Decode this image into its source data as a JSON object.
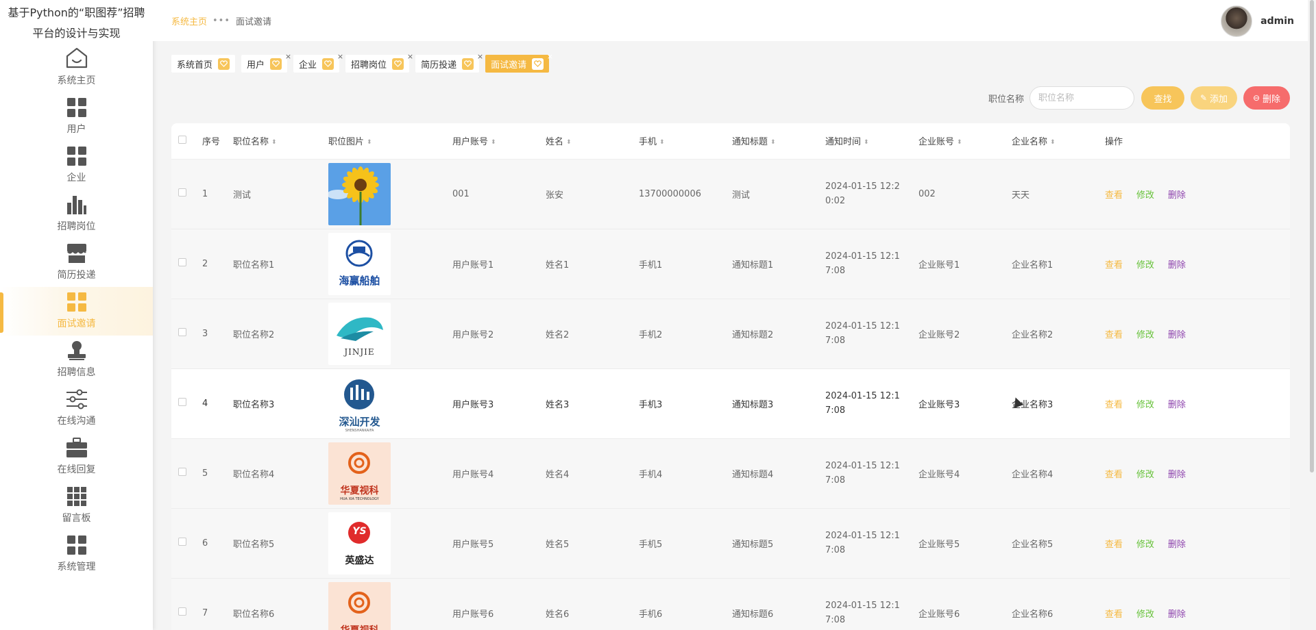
{
  "app": {
    "title": "基于Python的“职图荐”招聘平台的设计与实现"
  },
  "sidebar": {
    "items": [
      {
        "label": "系统主页",
        "icon": "home-icon"
      },
      {
        "label": "用户",
        "icon": "grid-icon"
      },
      {
        "label": "企业",
        "icon": "grid-icon"
      },
      {
        "label": "招聘岗位",
        "icon": "bar-chart-icon"
      },
      {
        "label": "简历投递",
        "icon": "store-icon"
      },
      {
        "label": "面试邀请",
        "icon": "grid-icon"
      },
      {
        "label": "招聘信息",
        "icon": "stamp-icon"
      },
      {
        "label": "在线沟通",
        "icon": "sliders-icon"
      },
      {
        "label": "在线回复",
        "icon": "briefcase-icon"
      },
      {
        "label": "留言板",
        "icon": "grid-nine-icon"
      },
      {
        "label": "系统管理",
        "icon": "grid-icon"
      }
    ]
  },
  "header": {
    "breadcrumb_home": "系统主页",
    "breadcrumb_sep": "•••",
    "breadcrumb_current": "面试邀请",
    "user_name": "admin"
  },
  "tags": [
    {
      "label": "系统首页"
    },
    {
      "label": "用户"
    },
    {
      "label": "企业"
    },
    {
      "label": "招聘岗位"
    },
    {
      "label": "简历投递"
    },
    {
      "label": "面试邀请"
    }
  ],
  "search": {
    "label": "职位名称",
    "placeholder": "职位名称",
    "find_label": "查找",
    "add_label": "添加",
    "delete_label": "删除"
  },
  "table": {
    "headers": [
      "序号",
      "职位名称",
      "职位图片",
      "用户账号",
      "姓名",
      "手机",
      "通知标题",
      "通知时间",
      "企业账号",
      "企业名称",
      "操作"
    ],
    "actions": {
      "view": "查看",
      "edit": "修改",
      "delete": "删除"
    },
    "rows": [
      {
        "no": "1",
        "job": "测试",
        "image": "sunflower",
        "account": "001",
        "name": "张安",
        "phone": "13700000006",
        "notice": "测试",
        "time": "2024-01-15 12:20:02",
        "company_account": "002",
        "company_name": "天天"
      },
      {
        "no": "2",
        "job": "职位名称1",
        "image": "haiying",
        "account": "用户账号1",
        "name": "姓名1",
        "phone": "手机1",
        "notice": "通知标题1",
        "time": "2024-01-15 12:17:08",
        "company_account": "企业账号1",
        "company_name": "企业名称1"
      },
      {
        "no": "3",
        "job": "职位名称2",
        "image": "jinjie",
        "account": "用户账号2",
        "name": "姓名2",
        "phone": "手机2",
        "notice": "通知标题2",
        "time": "2024-01-15 12:17:08",
        "company_account": "企业账号2",
        "company_name": "企业名称2"
      },
      {
        "no": "4",
        "job": "职位名称3",
        "image": "shenshan",
        "account": "用户账号3",
        "name": "姓名3",
        "phone": "手机3",
        "notice": "通知标题3",
        "time": "2024-01-15 12:17:08",
        "company_account": "企业账号3",
        "company_name": "企业名称3"
      },
      {
        "no": "5",
        "job": "职位名称4",
        "image": "huaxia",
        "account": "用户账号4",
        "name": "姓名4",
        "phone": "手机4",
        "notice": "通知标题4",
        "time": "2024-01-15 12:17:08",
        "company_account": "企业账号4",
        "company_name": "企业名称4"
      },
      {
        "no": "6",
        "job": "职位名称5",
        "image": "yingshengda",
        "account": "用户账号5",
        "name": "姓名5",
        "phone": "手机5",
        "notice": "通知标题5",
        "time": "2024-01-15 12:17:08",
        "company_account": "企业账号5",
        "company_name": "企业名称5"
      },
      {
        "no": "7",
        "job": "职位名称6",
        "image": "huaxia",
        "account": "用户账号6",
        "name": "姓名6",
        "phone": "手机6",
        "notice": "通知标题6",
        "time": "2024-01-15 12:17:08",
        "company_account": "企业账号6",
        "company_name": "企业名称6"
      }
    ]
  },
  "logos": {
    "haiying": "海赢船舶",
    "jinjie": "JINJIE",
    "shenshan": "深汕开发",
    "shenshan_sub": "SHENSHANKAIFA",
    "huaxia": "华夏视科",
    "huaxia_sub": "HUA XIA TECHNOLOGY",
    "yingshengda": "英盛达",
    "yingshengda_mark": "YS"
  },
  "colors": {
    "accent": "#f5b942",
    "edit": "#67c23a",
    "delete": "#8e44ad",
    "danger": "#f66c6c"
  }
}
